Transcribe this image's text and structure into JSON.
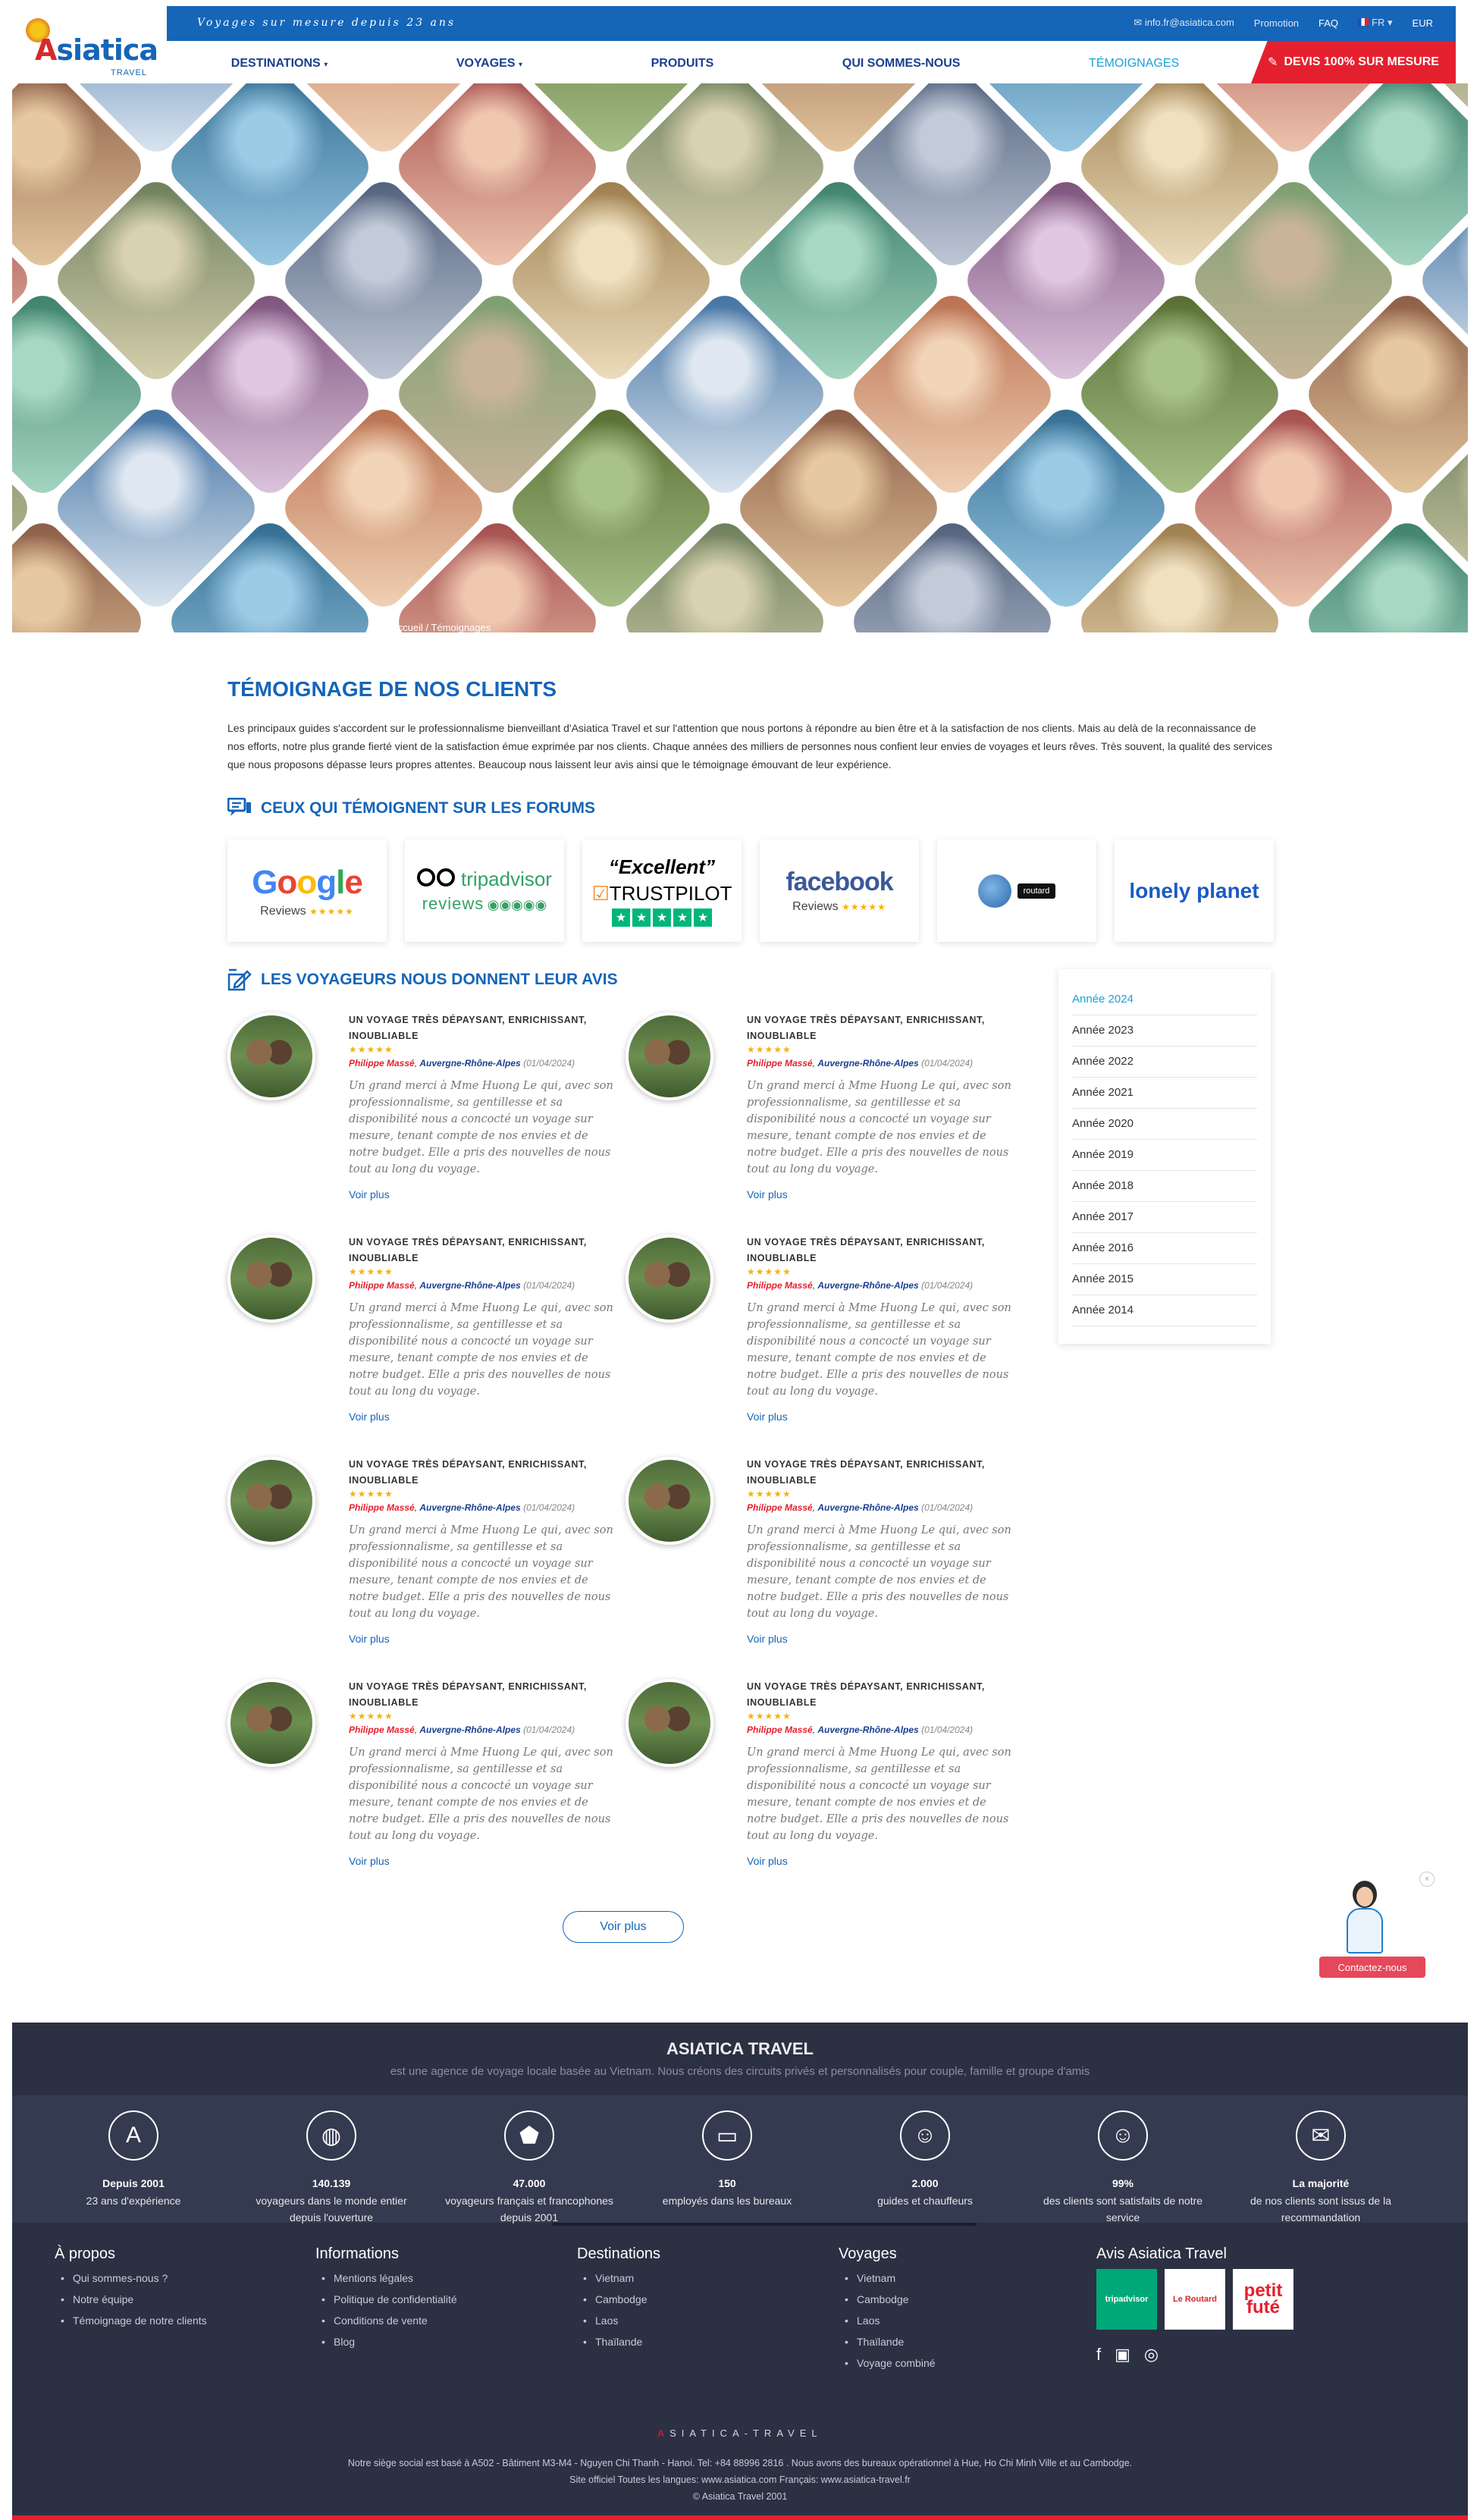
{
  "header": {
    "tagline": "Voyages sur mesure depuis 23 ans",
    "email": "info.fr@asiatica.com",
    "promotion": "Promotion",
    "faq": "FAQ",
    "language": "FR",
    "currency": "EUR",
    "logo_text": "Asiatica",
    "logo_sub": "TRAVEL"
  },
  "nav": {
    "items": [
      "DESTINATIONS",
      "VOYAGES",
      "PRODUITS",
      "QUI SOMMES-NOUS",
      "TÉMOIGNAGES"
    ],
    "devis": "DEVIS 100% SUR MESURE"
  },
  "hero": {
    "breadcrumb": "Accueil  /  Témoignages"
  },
  "main": {
    "title": "TÉMOIGNAGE DE NOS CLIENTS",
    "intro": "Les principaux guides s'accordent sur le professionnalisme bienveillant d'Asiatica Travel et sur l'attention que nous portons à répondre au bien être et à la satisfaction de nos clients. Mais au delà de la reconnaissance de nos efforts, notre plus grande fierté vient de la satisfaction émue exprimée par nos clients. Chaque années des milliers de personnes nous confient leur envies de voyages et leurs rêves. Très souvent, la qualité des services que nous proposons dépasse leurs propres attentes. Beaucoup nous laissent leur avis ainsi que le témoignage émouvant de leur expérience.",
    "forums_heading": "CEUX QUI TÉMOIGNENT SUR LES FORUMS",
    "forums": {
      "google": "Google",
      "google_sub": "Reviews",
      "tripadvisor": "tripadvisor",
      "tripadvisor_sub": "reviews",
      "trustpilot_top": "“Excellent”",
      "trustpilot": "TRUSTPILOT",
      "facebook": "facebook",
      "facebook_sub": "Reviews",
      "routard": "routard",
      "lonelyplanet": "lonely planet"
    },
    "voyageurs_heading": "LES VOYAGEURS NOUS DONNENT LEUR AVIS",
    "reviews": [
      {
        "title": "UN VOYAGE TRÈS DÉPAYSANT, ENRICHISSANT, INOUBLIABLE",
        "stars": "★★★★★",
        "author": "Philippe Massé",
        "region": "Auvergne-Rhône-Alpes",
        "date": "(01/04/2024)",
        "text": "Un grand merci à Mme Huong Le qui, avec son professionnalisme, sa gentillesse et sa disponibilité nous a concocté un voyage sur mesure, tenant compte de nos envies et de notre budget. Elle a pris des nouvelles de nous tout au long du voyage.",
        "more": "Voir plus"
      },
      {
        "title": "UN VOYAGE TRÈS DÉPAYSANT, ENRICHISSANT, INOUBLIABLE",
        "stars": "★★★★★",
        "author": "Philippe Massé",
        "region": "Auvergne-Rhône-Alpes",
        "date": "(01/04/2024)",
        "text": "Un grand merci à Mme Huong Le qui, avec son professionnalisme, sa gentillesse et sa disponibilité nous a concocté un voyage sur mesure, tenant compte de nos envies et de notre budget. Elle a pris des nouvelles de nous tout au long du voyage.",
        "more": "Voir plus"
      },
      {
        "title": "UN VOYAGE TRÈS DÉPAYSANT, ENRICHISSANT, INOUBLIABLE",
        "stars": "★★★★★",
        "author": "Philippe Massé",
        "region": "Auvergne-Rhône-Alpes",
        "date": "(01/04/2024)",
        "text": "Un grand merci à Mme Huong Le qui, avec son professionnalisme, sa gentillesse et sa disponibilité nous a concocté un voyage sur mesure, tenant compte de nos envies et de notre budget. Elle a pris des nouvelles de nous tout au long du voyage.",
        "more": "Voir plus"
      },
      {
        "title": "UN VOYAGE TRÈS DÉPAYSANT, ENRICHISSANT, INOUBLIABLE",
        "stars": "★★★★★",
        "author": "Philippe Massé",
        "region": "Auvergne-Rhône-Alpes",
        "date": "(01/04/2024)",
        "text": "Un grand merci à Mme Huong Le qui, avec son professionnalisme, sa gentillesse et sa disponibilité nous a concocté un voyage sur mesure, tenant compte de nos envies et de notre budget. Elle a pris des nouvelles de nous tout au long du voyage.",
        "more": "Voir plus"
      },
      {
        "title": "UN VOYAGE TRÈS DÉPAYSANT, ENRICHISSANT, INOUBLIABLE",
        "stars": "★★★★★",
        "author": "Philippe Massé",
        "region": "Auvergne-Rhône-Alpes",
        "date": "(01/04/2024)",
        "text": "Un grand merci à Mme Huong Le qui, avec son professionnalisme, sa gentillesse et sa disponibilité nous a concocté un voyage sur mesure, tenant compte de nos envies et de notre budget. Elle a pris des nouvelles de nous tout au long du voyage.",
        "more": "Voir plus"
      },
      {
        "title": "UN VOYAGE TRÈS DÉPAYSANT, ENRICHISSANT, INOUBLIABLE",
        "stars": "★★★★★",
        "author": "Philippe Massé",
        "region": "Auvergne-Rhône-Alpes",
        "date": "(01/04/2024)",
        "text": "Un grand merci à Mme Huong Le qui, avec son professionnalisme, sa gentillesse et sa disponibilité nous a concocté un voyage sur mesure, tenant compte de nos envies et de notre budget. Elle a pris des nouvelles de nous tout au long du voyage.",
        "more": "Voir plus"
      },
      {
        "title": "UN VOYAGE TRÈS DÉPAYSANT, ENRICHISSANT, INOUBLIABLE",
        "stars": "★★★★★",
        "author": "Philippe Massé",
        "region": "Auvergne-Rhône-Alpes",
        "date": "(01/04/2024)",
        "text": "Un grand merci à Mme Huong Le qui, avec son professionnalisme, sa gentillesse et sa disponibilité nous a concocté un voyage sur mesure, tenant compte de nos envies et de notre budget. Elle a pris des nouvelles de nous tout au long du voyage.",
        "more": "Voir plus"
      },
      {
        "title": "UN VOYAGE TRÈS DÉPAYSANT, ENRICHISSANT, INOUBLIABLE",
        "stars": "★★★★★",
        "author": "Philippe Massé",
        "region": "Auvergne-Rhône-Alpes",
        "date": "(01/04/2024)",
        "text": "Un grand merci à Mme Huong Le qui, avec son professionnalisme, sa gentillesse et sa disponibilité nous a concocté un voyage sur mesure, tenant compte de nos envies et de notre budget. Elle a pris des nouvelles de nous tout au long du voyage.",
        "more": "Voir plus"
      }
    ],
    "years": [
      "Année 2024",
      "Année 2023",
      "Année 2022",
      "Année 2021",
      "Année 2020",
      "Année 2019",
      "Année 2018",
      "Année 2017",
      "Année 2016",
      "Année 2015",
      "Année 2014"
    ],
    "load_more": "Voir plus"
  },
  "contact": {
    "label": "Contactez-nous",
    "close": "×"
  },
  "footer": {
    "title": "ASIATICA TRAVEL",
    "subtitle": "est une agence de voyage locale basée au Vietnam. Nous créons des circuits privés et personnalisés pour couple, famille et groupe d'amis",
    "stats": [
      {
        "num": "Depuis 2001",
        "label": "23 ans d'expérience",
        "icon": "logo-icon"
      },
      {
        "num": "140.139",
        "label": "voyageurs dans le monde entier depuis l'ouverture",
        "icon": "globe-icon"
      },
      {
        "num": "47.000",
        "label": "voyageurs français et francophones depuis 2001",
        "icon": "france-map-icon"
      },
      {
        "num": "150",
        "label": "employés dans les bureaux",
        "icon": "briefcase-icon"
      },
      {
        "num": "2.000",
        "label": "guides et chauffeurs",
        "icon": "guide-icon"
      },
      {
        "num": "99%",
        "label": "des clients sont satisfaits de notre service",
        "icon": "smile-icon"
      },
      {
        "num": "La majorité",
        "label": "de nos clients sont issus de la recommandation",
        "icon": "recommend-icon"
      }
    ],
    "columns": [
      {
        "title": "À propos",
        "items": [
          "Qui sommes-nous ?",
          "Notre équipe",
          "Témoignage de notre clients"
        ]
      },
      {
        "title": "Informations",
        "items": [
          "Mentions légales",
          "Politique de confidentialité",
          "Conditions de vente",
          "Blog"
        ]
      },
      {
        "title": "Destinations",
        "items": [
          "Vietnam",
          "Cambodge",
          "Laos",
          "Thaïlande"
        ]
      },
      {
        "title": "Voyages",
        "items": [
          "Vietnam",
          "Cambodge",
          "Laos",
          "Thaïlande",
          "Voyage combiné"
        ]
      }
    ],
    "avis_title": "Avis Asiatica Travel",
    "badges": [
      "tripadvisor",
      "Le Routard",
      "petit futé"
    ],
    "signature_first": "A",
    "signature_rest": "SIATICA-TRAVEL",
    "address1": "Notre siège social est basé à A502 - Bâtiment M3-M4 - Nguyen Chi Thanh - Hanoi.  Tel: +84 88996 2816 . Nous avons des bureaux opérationnel à Hue, Ho Chi Minh Ville et au Cambodge.",
    "address2": "Site officiel Toutes les langues: www.asiatica.com   Français: www.asiatica-travel.fr",
    "copyright": "© Asiatica Travel 2001"
  }
}
